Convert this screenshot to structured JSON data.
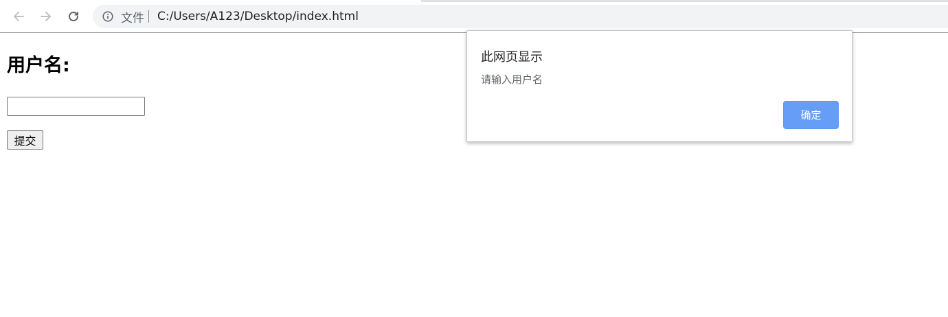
{
  "browser": {
    "scheme_label": "文件",
    "url": "C:/Users/A123/Desktop/index.html",
    "icons": {
      "back": "arrow-left-icon",
      "forward": "arrow-right-icon",
      "reload": "reload-icon",
      "site_info": "info-icon"
    }
  },
  "page": {
    "heading": "用户名:",
    "username_value": "",
    "submit_label": "提交"
  },
  "alert": {
    "title": "此网页显示",
    "message": "请输入用户名",
    "ok_label": "确定",
    "ok_color": "#669df6"
  }
}
